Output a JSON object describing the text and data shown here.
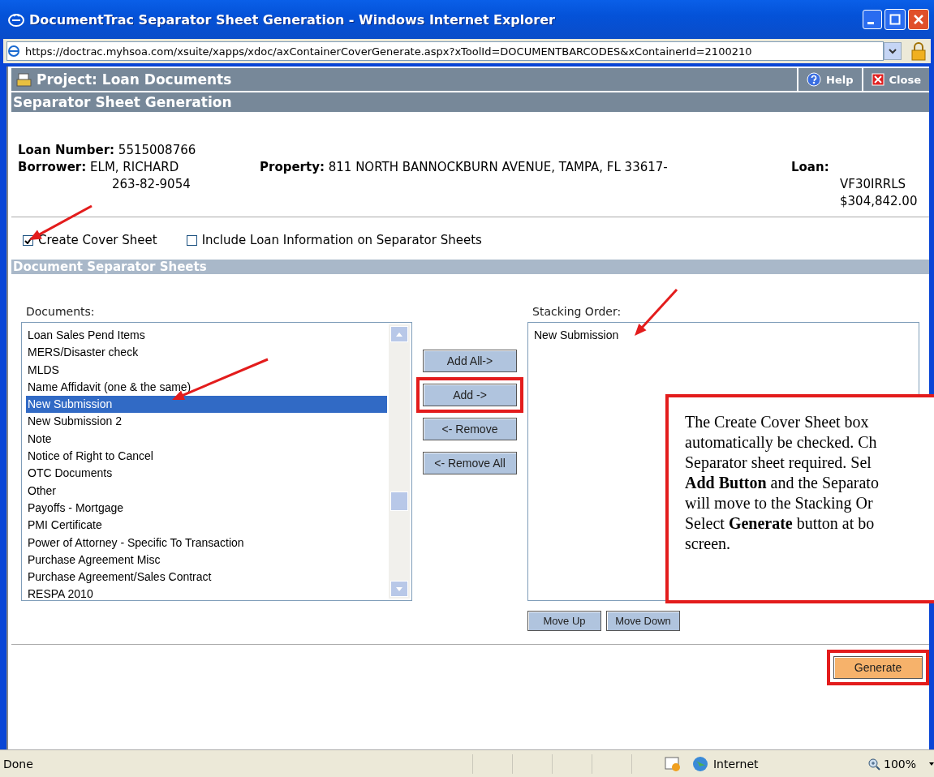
{
  "window": {
    "title": "DocumentTrac Separator Sheet Generation - Windows Internet Explorer"
  },
  "address_bar": {
    "url": "https://doctrac.myhsoa.com/xsuite/xapps/xdoc/axContainerCoverGenerate.aspx?xToolId=DOCUMENTBARCODES&xContainerId=2100210"
  },
  "header": {
    "title": "Project: Loan Documents",
    "buttons": [
      {
        "kind": "help",
        "label": "Help"
      },
      {
        "kind": "close",
        "label": "Close"
      }
    ]
  },
  "subheader": "Separator Sheet Generation",
  "loan_info": {
    "loan_number": {
      "label": "Loan Number:",
      "value": "5515008766"
    },
    "borrower": {
      "label": "Borrower:",
      "values": [
        "ELM, RICHARD",
        "263-82-9054"
      ]
    },
    "property": {
      "label": "Property:",
      "value": "811 NORTH BANNOCKBURN AVENUE, TAMPA, FL 33617-"
    },
    "loan": {
      "label": "Loan:",
      "values": [
        "VF30IRRLS",
        "$304,842.00"
      ]
    }
  },
  "options": [
    {
      "label": "Create Cover Sheet",
      "checked": true
    },
    {
      "label": "Include Loan Information on Separator Sheets",
      "checked": false
    }
  ],
  "section": "Document Separator Sheets",
  "documents": {
    "label": "Documents:",
    "items": [
      {
        "text": "Loan Sales Pend Items",
        "selected": false
      },
      {
        "text": "MERS/Disaster check",
        "selected": false
      },
      {
        "text": "MLDS",
        "selected": false
      },
      {
        "text": "Name Affidavit (one & the same)",
        "selected": false
      },
      {
        "text": "New Submission",
        "selected": true
      },
      {
        "text": "New Submission 2",
        "selected": false
      },
      {
        "text": "Note",
        "selected": false
      },
      {
        "text": "Notice of Right to Cancel",
        "selected": false
      },
      {
        "text": "OTC Documents",
        "selected": false
      },
      {
        "text": "Other",
        "selected": false
      },
      {
        "text": "Payoffs - Mortgage",
        "selected": false
      },
      {
        "text": "PMI Certificate",
        "selected": false
      },
      {
        "text": "Power of Attorney - Specific To Transaction",
        "selected": false
      },
      {
        "text": "Purchase Agreement Misc",
        "selected": false
      },
      {
        "text": "Purchase Agreement/Sales Contract",
        "selected": false
      },
      {
        "text": "RESPA 2010",
        "selected": false
      }
    ]
  },
  "transfer_buttons": [
    {
      "label": "Add All->",
      "highlighted": false
    },
    {
      "label": "Add ->",
      "highlighted": true
    },
    {
      "label": "<- Remove",
      "highlighted": false
    },
    {
      "label": "<- Remove All",
      "highlighted": false
    }
  ],
  "stacking_order": {
    "label": "Stacking Order:",
    "items": [
      {
        "text": "New Submission",
        "selected": false
      }
    ]
  },
  "order_buttons": [
    "Move Up",
    "Move Down"
  ],
  "generate_button": {
    "label": "Generate",
    "highlighted": true
  },
  "callout": {
    "lines": [
      "The Create Cover Sheet box",
      "automatically be checked. Ch",
      "Separator sheet required.  Sel",
      "**Add Button** and the Separato",
      "will move to the Stacking Or",
      "Select **Generate** button at bo",
      "screen."
    ]
  },
  "status_bar": {
    "text": "Done",
    "zone": "Internet",
    "zoom": "100%"
  }
}
